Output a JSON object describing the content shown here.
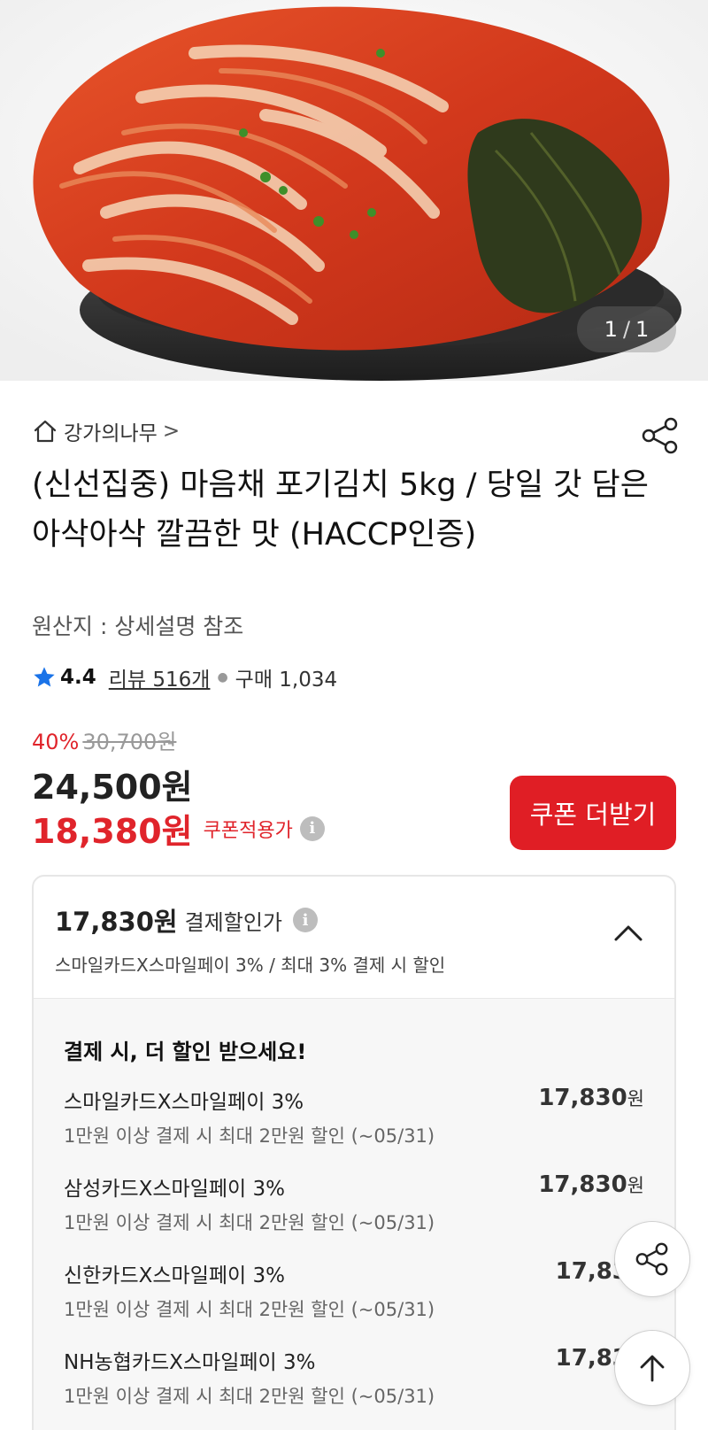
{
  "hero": {
    "page_current": "1",
    "page_separator": "/",
    "page_total": "1"
  },
  "seller": {
    "name": "강가의나무",
    "chevron": ">"
  },
  "product": {
    "title": "(신선집중) 마음채 포기김치 5kg / 당일 갓 담은 아삭아삭 깔끔한 맛 (HACCP인증)",
    "origin": "원산지 : 상세설명 참조",
    "rating": "4.4",
    "reviews": "리뷰 516개",
    "purchases": "구매 1,034"
  },
  "pricing": {
    "discount_pct": "40%",
    "original_price": "30,700원",
    "sale_price": "24,500원",
    "coupon_price": "18,380원",
    "coupon_label": "쿠폰적용가",
    "coupon_button": "쿠폰 더받기"
  },
  "payment": {
    "amount": "17,830원",
    "label": "결제할인가",
    "summary": "스마일카드X스마일페이 3% / 최대 3% 결제 시 할인",
    "heading": "결제 시, 더 할인 받으세요!",
    "cards": [
      {
        "name": "스마일카드X스마일페이 3%",
        "desc": "1만원 이상 결제 시 최대 2만원 할인 (~05/31)",
        "price": "17,830",
        "unit": "원"
      },
      {
        "name": "삼성카드X스마일페이 3%",
        "desc": "1만원 이상 결제 시 최대 2만원 할인 (~05/31)",
        "price": "17,830",
        "unit": "원"
      },
      {
        "name": "신한카드X스마일페이 3%",
        "desc": "1만원 이상 결제 시 최대 2만원 할인 (~05/31)",
        "price": "17,830",
        "unit": ""
      },
      {
        "name": "NH농협카드X스마일페이 3%",
        "desc": "1만원 이상 결제 시 최대 2만원 할인 (~05/31)",
        "price": "17,830",
        "unit": ""
      }
    ]
  },
  "icons": {
    "home": "home-icon",
    "share": "share-icon",
    "star": "star-icon",
    "info": "info-icon",
    "chevron_up": "chevron-up-icon",
    "arrow_up": "arrow-up-icon"
  },
  "colors": {
    "accent_red": "#e01e25",
    "star_blue": "#1a73e8"
  }
}
